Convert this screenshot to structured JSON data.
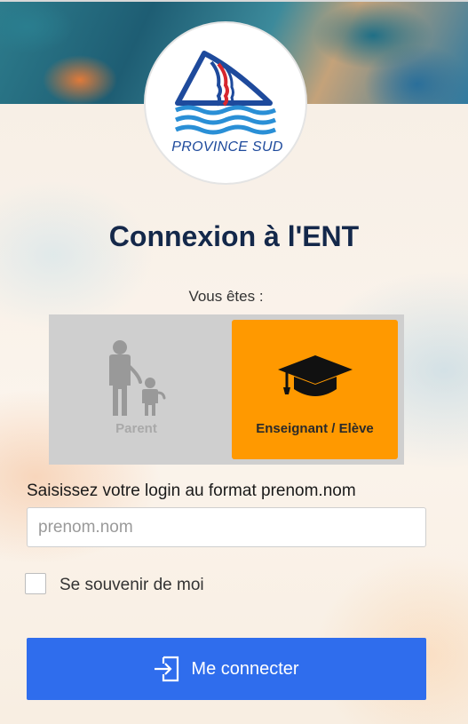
{
  "branding": {
    "logo_text": "PROVINCE SUD",
    "colors": {
      "logo_blue": "#1e4a9c",
      "logo_red": "#d7262e",
      "wave_blue": "#2a8fd6"
    }
  },
  "login": {
    "title": "Connexion à l'ENT",
    "profile_prompt": "Vous êtes :",
    "profiles": [
      {
        "label": "Parent",
        "icon": "parent-child-icon",
        "selected": false
      },
      {
        "label": "Enseignant / Elève",
        "icon": "graduation-cap-icon",
        "selected": true
      }
    ],
    "login_label": "Saisissez votre login au format prenom.nom",
    "login_placeholder": "prenom.nom",
    "login_value": "",
    "remember_label": "Se souvenir de moi",
    "remember_checked": false,
    "submit_label": "Me connecter",
    "submit_icon": "sign-in-icon",
    "colors": {
      "selected_profile": "#ff9900",
      "profile_box": "#cfcfcf",
      "submit_button": "#2f6ded",
      "title": "#14284a"
    }
  }
}
